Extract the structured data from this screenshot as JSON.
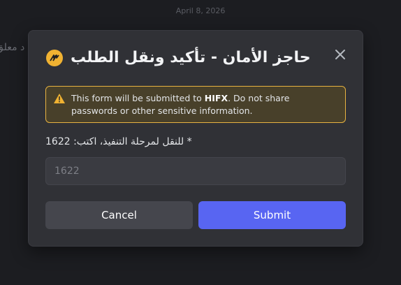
{
  "background": {
    "date_divider": "April 8, 2026",
    "partial_message": "د معلق"
  },
  "modal": {
    "title": "حاجز الأمان - تأكيد ونقل الطلب",
    "app_icon": "bot-app-icon",
    "close_icon": "close-icon",
    "warning": {
      "icon": "warning-triangle-icon",
      "prefix": "This form will be submitted to ",
      "target": "HIFX",
      "suffix": ". Do not share passwords or other sensitive information."
    },
    "field": {
      "required_mark": "*",
      "label": "للنقل لمرحلة التنفيذ، اكتب: 1622",
      "value": "",
      "placeholder": "1622"
    },
    "buttons": {
      "cancel": "Cancel",
      "submit": "Submit"
    }
  },
  "colors": {
    "accent": "#5865f2",
    "warning_border": "#e8b341",
    "warning_bg": "#48402a",
    "modal_bg": "#303136",
    "icon_bg": "#f0b232"
  }
}
